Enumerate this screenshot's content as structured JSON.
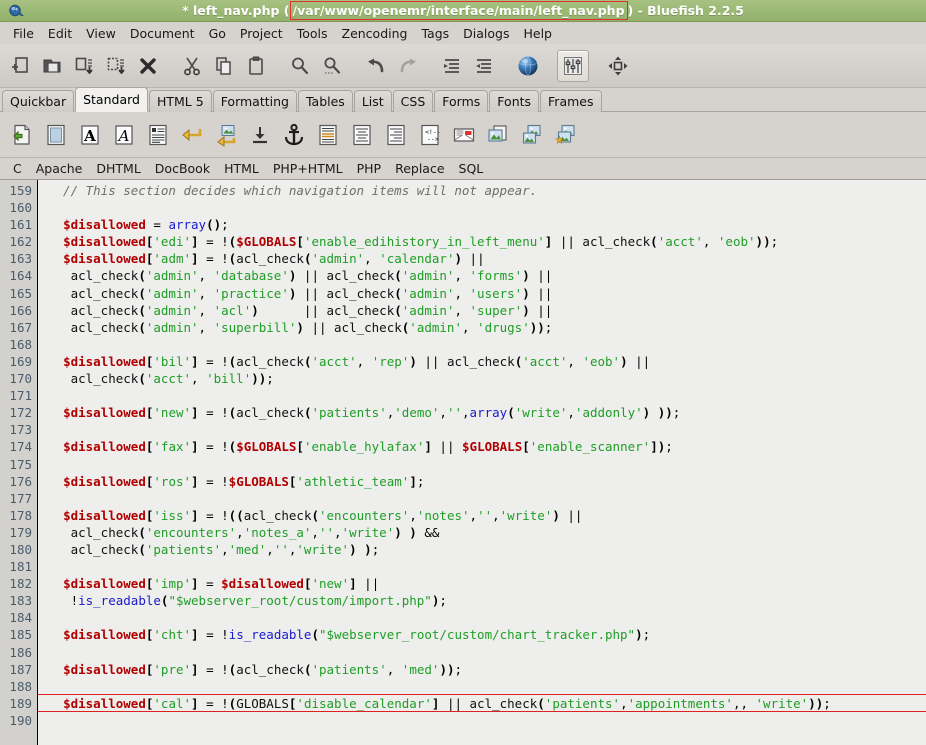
{
  "window": {
    "title_prefix": "* left_nav.php (",
    "highlighted_path": "/var/www/openemr/interface/main/left_nav.php",
    "title_suffix": ") - Bluefish 2.2.5",
    "app_icon": "bluefish-icon",
    "titlebar_color": "#9dba76",
    "highlight_color": "#e02020"
  },
  "menubar": {
    "items": [
      {
        "label": "File",
        "name": "menu-file"
      },
      {
        "label": "Edit",
        "name": "menu-edit"
      },
      {
        "label": "View",
        "name": "menu-view"
      },
      {
        "label": "Document",
        "name": "menu-document"
      },
      {
        "label": "Go",
        "name": "menu-go"
      },
      {
        "label": "Project",
        "name": "menu-project"
      },
      {
        "label": "Tools",
        "name": "menu-tools"
      },
      {
        "label": "Zencoding",
        "name": "menu-zencoding"
      },
      {
        "label": "Tags",
        "name": "menu-tags"
      },
      {
        "label": "Dialogs",
        "name": "menu-dialogs"
      },
      {
        "label": "Help",
        "name": "menu-help"
      }
    ]
  },
  "main_toolbar": {
    "buttons": [
      {
        "name": "new-file-icon",
        "tooltip": "New file"
      },
      {
        "name": "open-file-icon",
        "tooltip": "Open file"
      },
      {
        "name": "save-file-icon",
        "tooltip": "Save file"
      },
      {
        "name": "save-as-icon",
        "tooltip": "Save file as"
      },
      {
        "name": "close-file-icon",
        "tooltip": "Close file"
      },
      {
        "name": "cut-icon",
        "tooltip": "Cut"
      },
      {
        "name": "copy-icon",
        "tooltip": "Copy"
      },
      {
        "name": "paste-icon",
        "tooltip": "Paste"
      },
      {
        "name": "find-icon",
        "tooltip": "Find"
      },
      {
        "name": "replace-icon",
        "tooltip": "Replace"
      },
      {
        "name": "undo-icon",
        "tooltip": "Undo"
      },
      {
        "name": "redo-icon",
        "tooltip": "Redo"
      },
      {
        "name": "unindent-icon",
        "tooltip": "Unindent"
      },
      {
        "name": "indent-icon",
        "tooltip": "Indent"
      },
      {
        "name": "preview-browser-icon",
        "tooltip": "Preview in browser"
      },
      {
        "name": "preferences-icon",
        "tooltip": "Edit preferences"
      },
      {
        "name": "fullscreen-icon",
        "tooltip": "Fullscreen"
      }
    ]
  },
  "tabs": {
    "active": "Standard",
    "items": [
      {
        "label": "Quickbar",
        "name": "tab-quickbar"
      },
      {
        "label": "Standard",
        "name": "tab-standard"
      },
      {
        "label": "HTML 5",
        "name": "tab-html5"
      },
      {
        "label": "Formatting",
        "name": "tab-formatting"
      },
      {
        "label": "Tables",
        "name": "tab-tables"
      },
      {
        "label": "List",
        "name": "tab-list"
      },
      {
        "label": "CSS",
        "name": "tab-css"
      },
      {
        "label": "Forms",
        "name": "tab-forms"
      },
      {
        "label": "Fonts",
        "name": "tab-fonts"
      },
      {
        "label": "Frames",
        "name": "tab-frames"
      }
    ]
  },
  "widget_toolbar": {
    "buttons": [
      {
        "name": "quickstart-icon",
        "tooltip": "Quickstart"
      },
      {
        "name": "body-icon",
        "tooltip": "Body"
      },
      {
        "name": "bold-icon",
        "tooltip": "Bold"
      },
      {
        "name": "italic-icon",
        "tooltip": "Italic"
      },
      {
        "name": "paragraph-icon",
        "tooltip": "Paragraph"
      },
      {
        "name": "break-icon",
        "tooltip": "Break"
      },
      {
        "name": "break-clear-icon",
        "tooltip": "Break and clear"
      },
      {
        "name": "non-breaking-space-icon",
        "tooltip": "Non-breaking space"
      },
      {
        "name": "anchor-icon",
        "tooltip": "Anchor"
      },
      {
        "name": "align-left-icon",
        "tooltip": "Rule / align left"
      },
      {
        "name": "center-icon",
        "tooltip": "Center"
      },
      {
        "name": "right-justify-icon",
        "tooltip": "Right justify"
      },
      {
        "name": "comment-icon",
        "tooltip": "Comment"
      },
      {
        "name": "email-icon",
        "tooltip": "E-mail"
      },
      {
        "name": "image-icon",
        "tooltip": "Insert image"
      },
      {
        "name": "thumbnail-icon",
        "tooltip": "Insert thumbnail"
      },
      {
        "name": "multi-thumbnail-icon",
        "tooltip": "Multi thumbnail"
      }
    ]
  },
  "lang_toolbar": {
    "items": [
      {
        "label": "C",
        "name": "lang-c"
      },
      {
        "label": "Apache",
        "name": "lang-apache"
      },
      {
        "label": "DHTML",
        "name": "lang-dhtml"
      },
      {
        "label": "DocBook",
        "name": "lang-docbook"
      },
      {
        "label": "HTML",
        "name": "lang-html"
      },
      {
        "label": "PHP+HTML",
        "name": "lang-php-html"
      },
      {
        "label": "PHP",
        "name": "lang-php"
      },
      {
        "label": "Replace",
        "name": "lang-replace"
      },
      {
        "label": "SQL",
        "name": "lang-sql"
      }
    ]
  },
  "editor": {
    "first_line": 159,
    "last_line": 190,
    "highlighted_line": 189,
    "line_numbers": [
      159,
      160,
      161,
      162,
      163,
      164,
      165,
      166,
      167,
      168,
      169,
      170,
      171,
      172,
      173,
      174,
      175,
      176,
      177,
      178,
      179,
      180,
      181,
      182,
      183,
      184,
      185,
      186,
      187,
      188,
      189,
      190
    ],
    "lines": [
      "  // This section decides which navigation items will not appear.",
      "",
      "  $disallowed = array();",
      "  $disallowed['edi'] = !($GLOBALS['enable_edihistory_in_left_menu'] || acl_check('acct', 'eob'));",
      "  $disallowed['adm'] = !(acl_check('admin', 'calendar') ||",
      "   acl_check('admin', 'database') || acl_check('admin', 'forms') ||",
      "   acl_check('admin', 'practice') || acl_check('admin', 'users') ||",
      "   acl_check('admin', 'acl')      || acl_check('admin', 'super') ||",
      "   acl_check('admin', 'superbill') || acl_check('admin', 'drugs'));",
      "",
      "  $disallowed['bil'] = !(acl_check('acct', 'rep') || acl_check('acct', 'eob') ||",
      "   acl_check('acct', 'bill'));",
      "",
      "  $disallowed['new'] = !(acl_check('patients','demo','',array('write','addonly') ));",
      "",
      "  $disallowed['fax'] = !($GLOBALS['enable_hylafax'] || $GLOBALS['enable_scanner']);",
      "",
      "  $disallowed['ros'] = !$GLOBALS['athletic_team'];",
      "",
      "  $disallowed['iss'] = !((acl_check('encounters','notes','','write') ||",
      "   acl_check('encounters','notes_a','','write') ) &&",
      "   acl_check('patients','med','','write') );",
      "",
      "  $disallowed['imp'] = $disallowed['new'] ||",
      "   !is_readable(\"$webserver_root/custom/import.php\");",
      "",
      "  $disallowed['cht'] = !is_readable(\"$webserver_root/custom/chart_tracker.php\");",
      "",
      "  $disallowed['pre'] = !(acl_check('patients', 'med'));",
      "",
      "  $disallowed['cal'] = !(GLOBALS['disable_calendar'] || acl_check('patients','appointments',, 'write'));",
      ""
    ],
    "colors": {
      "comment": "#6e6e6e",
      "variable": "#b00000",
      "string": "#1f9e26",
      "function": "#1a1acc",
      "bracket": "#000000",
      "background": "#eeeeec",
      "gutter_background": "#d3d1cd",
      "gutter_text": "#4a5c6b"
    }
  }
}
